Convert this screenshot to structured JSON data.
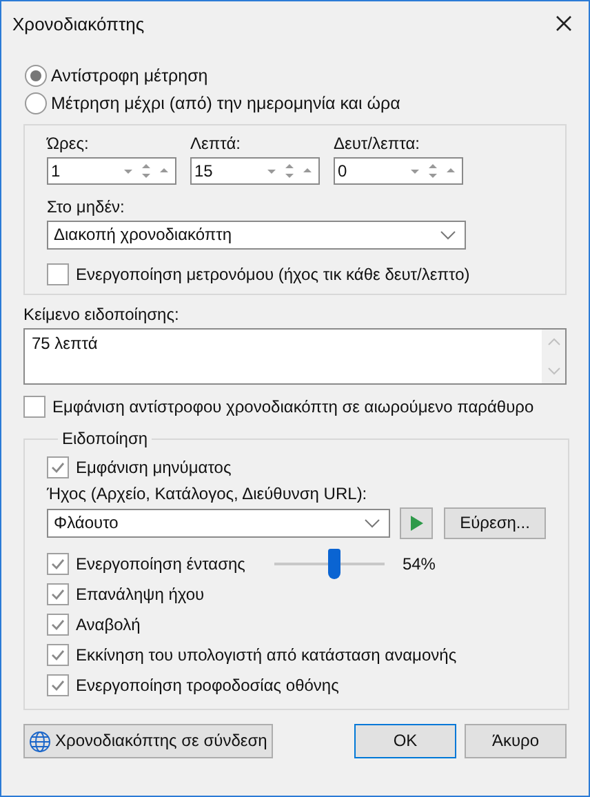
{
  "window": {
    "title": "Χρονοδιακόπτης"
  },
  "modes": [
    {
      "label": "Αντίστροφη μέτρηση",
      "selected": true
    },
    {
      "label": "Μέτρηση μέχρι (από) την ημερομηνία και ώρα",
      "selected": false
    }
  ],
  "duration": {
    "fields": [
      {
        "label": "Ώρες:",
        "value": "1"
      },
      {
        "label": "Λεπτά:",
        "value": "15"
      },
      {
        "label": "Δευτ/λεπτα:",
        "value": "0"
      }
    ],
    "at_zero": {
      "label": "Στο μηδέν:",
      "value": "Διακοπή χρονοδιακόπτη"
    },
    "metronome": {
      "label": "Ενεργοποίηση μετρονόμου (ήχος τικ κάθε δευτ/λεπτο)",
      "checked": false
    }
  },
  "notification_text": {
    "label": "Κείμενο ειδοποίησης:",
    "value": "75 λεπτά"
  },
  "floating_window": {
    "label": "Εμφάνιση αντίστροφου χρονοδιακόπτη σε αιωρούμενο παράθυρο",
    "checked": false
  },
  "notification": {
    "title": "Ειδοποίηση",
    "show_message": {
      "label": "Εμφάνιση μηνύματος",
      "checked": true
    },
    "sound": {
      "label": "Ήχος (Αρχείο, Κατάλογος, Διεύθυνση URL):",
      "value": "Φλάουτο",
      "browse": "Εύρεση..."
    },
    "volume": {
      "label": "Ενεργοποίηση έντασης",
      "checked": true,
      "level": 0.54,
      "reading": "54%"
    },
    "options": [
      {
        "label": "Επανάληψη ήχου",
        "checked": true
      },
      {
        "label": "Αναβολή",
        "checked": true
      },
      {
        "label": "Εκκίνηση του υπολογιστή από κατάσταση αναμονής",
        "checked": true
      },
      {
        "label": "Ενεργοποίηση τροφοδοσίας οθόνης",
        "checked": true
      }
    ]
  },
  "buttons": {
    "online": "Χρονοδιακόπτης σε σύνδεση",
    "ok": "OK",
    "cancel": "Άκυρο"
  }
}
